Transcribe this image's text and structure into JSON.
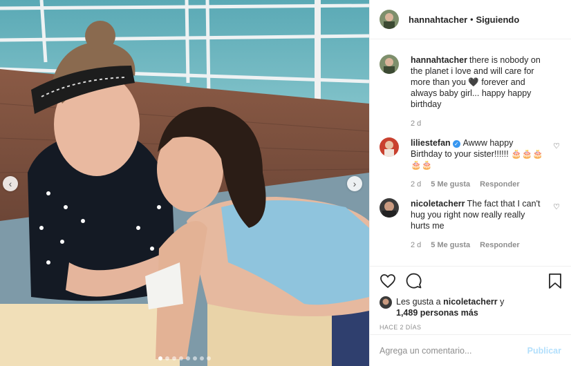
{
  "post": {
    "author": "hannahtacher",
    "separator": "•",
    "follow_status": "Siguiendo"
  },
  "media": {
    "prev_glyph": "‹",
    "next_glyph": "›",
    "dots": 8,
    "active_dot": 0
  },
  "caption": {
    "user": "hannahtacher",
    "text": "there is nobody on the planet i love and will care for more than you 🖤 forever and always baby girl... happy happy birthday",
    "time": "2 d"
  },
  "comments": [
    {
      "user": "liliestefan",
      "verified": true,
      "text": "Awww happy Birthday to your sister!!!!!! 🎂🎂🎂🎂🎂",
      "time": "2 d",
      "likes": "5 Me gusta",
      "reply": "Responder"
    },
    {
      "user": "nicoletacherr",
      "verified": false,
      "text": "The fact that I can't hug you right now really really hurts me",
      "time": "2 d",
      "likes": "5 Me gusta",
      "reply": "Responder"
    }
  ],
  "likes": {
    "prefix": "Les gusta a",
    "user": "nicoletacherr",
    "joiner": "y",
    "count": "1,489 personas más"
  },
  "timestamp": "HACE 2 DÍAS",
  "add_comment": {
    "placeholder": "Agrega un comentario...",
    "publish": "Publicar"
  },
  "colors": {
    "accent_link": "#3897f0",
    "publish_disabled": "#b2dffc",
    "meta_text": "#8e8e8e"
  },
  "icons": [
    "heart-icon",
    "comment-icon",
    "bookmark-icon",
    "verified-badge-icon",
    "small-heart-icon"
  ]
}
